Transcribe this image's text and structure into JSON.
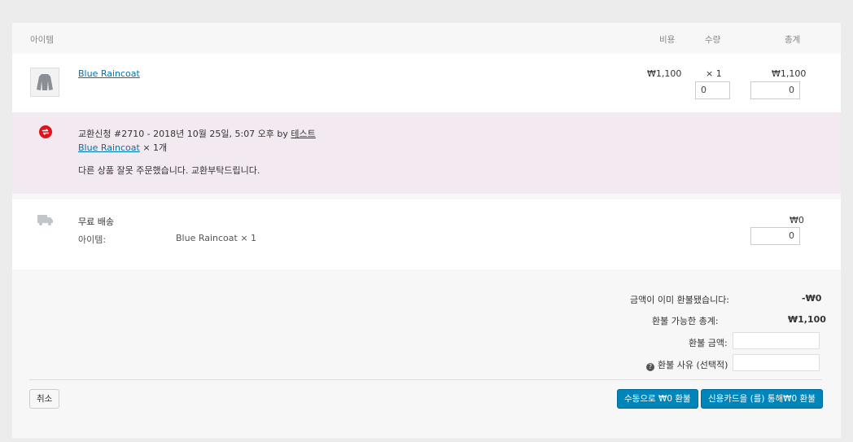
{
  "header": {
    "item": "아이템",
    "cost": "비용",
    "qty": "수량",
    "total": "총계"
  },
  "line_item": {
    "name": "Blue Raincoat",
    "cost": "₩1,100",
    "qty": "× 1",
    "total": "₩1,100",
    "refund_qty": "0",
    "refund_total": "0"
  },
  "refund_note": {
    "title": "교환신청 #2710 - 2018년 10월 25일, 5:07 오후 by ",
    "by_user": "테스트",
    "item_link": "Blue Raincoat",
    "item_qty": " × 1개",
    "message": "다른 상품 잘못 주문했습니다. 교환부탁드립니다."
  },
  "shipping": {
    "method": "무료 배송",
    "items_label": "아이템:",
    "items_value": "Blue Raincoat × 1",
    "cost": "₩0",
    "refund_value": "0"
  },
  "totals": {
    "refunded_label": "금액이 이미 환불됐습니다:",
    "refunded_value": "-₩0",
    "available_label": "환불 가능한 총계:",
    "available_value": "₩1,100",
    "refund_amount_label": "환불 금액:",
    "refund_reason_label": "환불 사유 (선택적)"
  },
  "buttons": {
    "cancel": "취소",
    "manual_refund": "수동으로 ₩0 환불",
    "card_refund": "신용카드을 (를) 통해₩0 환불"
  },
  "colors": {
    "accent": "#0085ba",
    "note_bg": "#f3e9f0",
    "badge_red": "#e0121a"
  }
}
